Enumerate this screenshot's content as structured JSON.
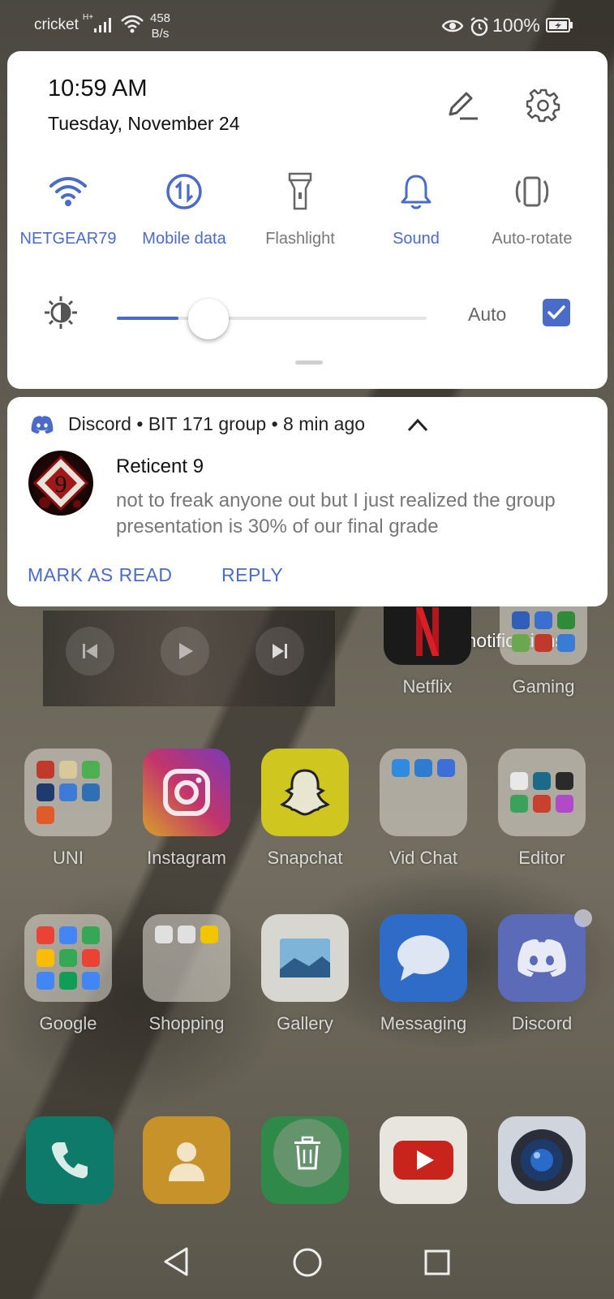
{
  "status_bar": {
    "carrier": "cricket",
    "network_type": "H+",
    "speed_value": "458",
    "speed_unit": "B/s",
    "battery_percent": "100%",
    "icons": [
      "signal-icon",
      "wifi-icon",
      "eye-comfort-icon",
      "alarm-icon",
      "battery-charging-icon"
    ]
  },
  "quick_settings": {
    "time": "10:59 AM",
    "date": "Tuesday, November 24",
    "tiles": [
      {
        "label": "NETGEAR79",
        "icon": "wifi-icon",
        "active": true
      },
      {
        "label": "Mobile data",
        "icon": "mobile-data-icon",
        "active": true
      },
      {
        "label": "Flashlight",
        "icon": "flashlight-icon",
        "active": false
      },
      {
        "label": "Sound",
        "icon": "bell-icon",
        "active": true
      },
      {
        "label": "Auto-rotate",
        "icon": "auto-rotate-icon",
        "active": false
      }
    ],
    "brightness": {
      "level": 0.2,
      "auto_label": "Auto",
      "auto_checked": true
    },
    "accent_color": "#4a6bc8"
  },
  "notification": {
    "app": "Discord",
    "channel": "BIT 171 group",
    "age": "8 min ago",
    "sender": "Reticent 9",
    "message": "not to freak anyone out but I just realized the group presentation is 30% of our final grade",
    "actions": [
      "MARK AS READ",
      "REPLY"
    ]
  },
  "home_screen": {
    "manage_notifications": "Manage notifications",
    "apps": [
      {
        "label": "Netflix"
      },
      {
        "label": "Gaming"
      },
      {
        "label": "UNI"
      },
      {
        "label": "Instagram"
      },
      {
        "label": "Snapchat"
      },
      {
        "label": "Vid Chat"
      },
      {
        "label": "Editor"
      },
      {
        "label": "Google"
      },
      {
        "label": "Shopping"
      },
      {
        "label": "Gallery"
      },
      {
        "label": "Messaging"
      },
      {
        "label": "Discord"
      }
    ]
  }
}
